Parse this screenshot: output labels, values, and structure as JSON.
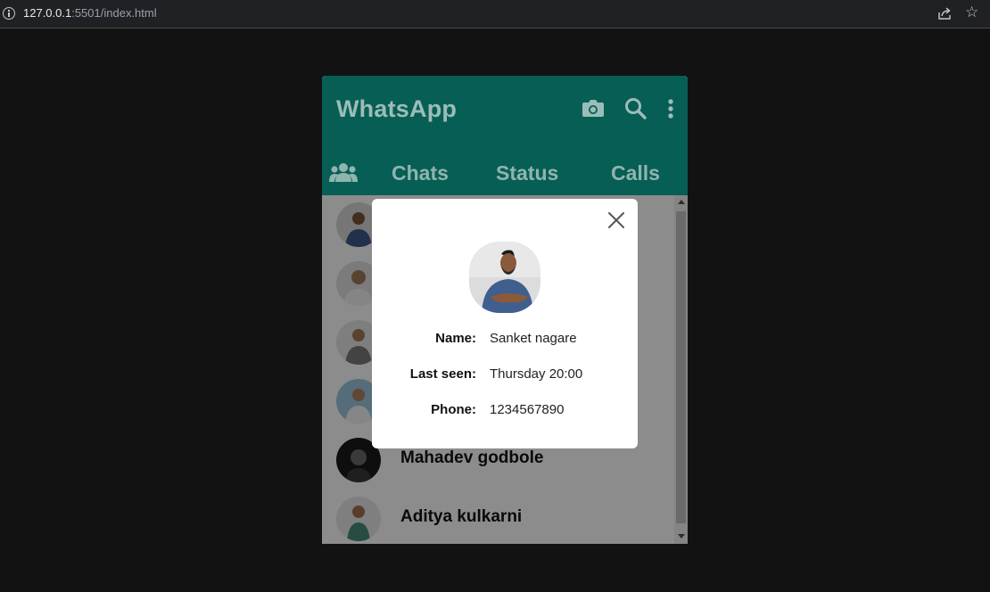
{
  "browser": {
    "url_host": "127.0.0.1",
    "url_rest": ":5501/index.html"
  },
  "app": {
    "title": "WhatsApp",
    "header_icons": [
      "camera-icon",
      "search-icon",
      "more-vert-icon"
    ],
    "tabs": [
      {
        "label": "Chats"
      },
      {
        "label": "Status"
      },
      {
        "label": "Calls"
      }
    ],
    "colors": {
      "header": "#075e54",
      "title": "#9bbdb8"
    }
  },
  "chats": [
    {
      "name": ""
    },
    {
      "name": ""
    },
    {
      "name": ""
    },
    {
      "name": ""
    },
    {
      "name": "Mahadev godbole"
    },
    {
      "name": "Aditya kulkarni"
    }
  ],
  "modal": {
    "rows": [
      {
        "label": "Name:",
        "value": "Sanket nagare"
      },
      {
        "label": "Last seen:",
        "value": "Thursday 20:00"
      },
      {
        "label": "Phone:",
        "value": "1234567890"
      }
    ]
  }
}
